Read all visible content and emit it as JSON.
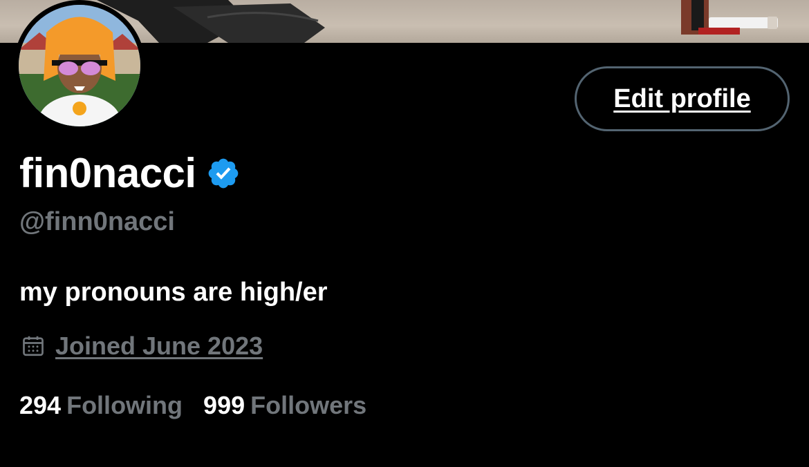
{
  "profile": {
    "display_name": "fin0nacci",
    "handle": "@finn0nacci",
    "bio": "my pronouns are high/er",
    "joined": "Joined June 2023",
    "verified": true
  },
  "actions": {
    "edit_profile_label": "Edit profile"
  },
  "stats": {
    "following_count": "294",
    "following_label": "Following",
    "followers_count": "999",
    "followers_label": "Followers"
  },
  "icons": {
    "verified": "verified-badge-icon",
    "calendar": "calendar-icon"
  },
  "colors": {
    "background": "#000000",
    "secondary_text": "#71767b",
    "verified_blue": "#1d9bf0",
    "button_border": "#536471"
  }
}
